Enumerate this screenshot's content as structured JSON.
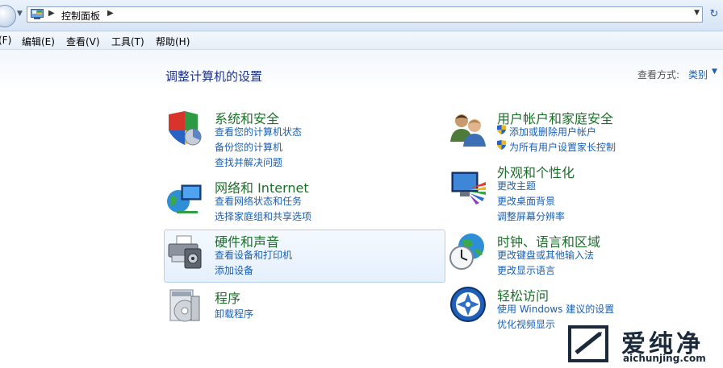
{
  "address_bar": {
    "breadcrumb": "控制面板"
  },
  "menu": [
    "(F)",
    "编辑(E)",
    "查看(V)",
    "工具(T)",
    "帮助(H)"
  ],
  "page_title": "调整计算机的设置",
  "view_by": {
    "label": "查看方式:",
    "value": "类别"
  },
  "categories": [
    {
      "title": "系统和安全",
      "links": [
        "查看您的计算机状态",
        "备份您的计算机",
        "查找并解决问题"
      ]
    },
    {
      "title": "网络和 Internet",
      "links": [
        "查看网络状态和任务",
        "选择家庭组和共享选项"
      ]
    },
    {
      "title": "硬件和声音",
      "links": [
        "查看设备和打印机",
        "添加设备"
      ]
    },
    {
      "title": "程序",
      "links": [
        "卸载程序"
      ]
    },
    {
      "title": "用户帐户和家庭安全",
      "links": [
        "添加或删除用户帐户",
        "为所有用户设置家长控制"
      ]
    },
    {
      "title": "外观和个性化",
      "links": [
        "更改主题",
        "更改桌面背景",
        "调整屏幕分辨率"
      ]
    },
    {
      "title": "时钟、语言和区域",
      "links": [
        "更改键盘或其他输入法",
        "更改显示语言"
      ]
    },
    {
      "title": "轻松访问",
      "links": [
        "使用 Windows 建议的设置",
        "优化视频显示"
      ]
    }
  ],
  "watermark": {
    "brand": "爱纯净",
    "url": "aichunjing.com"
  },
  "icons": [
    "back-icon",
    "control-panel-icon",
    "refresh-icon",
    "shield-icon",
    "network-icon",
    "printer-icon",
    "programs-icon",
    "users-icon",
    "display-icon",
    "globe-clock-icon",
    "ease-of-access-icon",
    "uac-shield-icon"
  ]
}
